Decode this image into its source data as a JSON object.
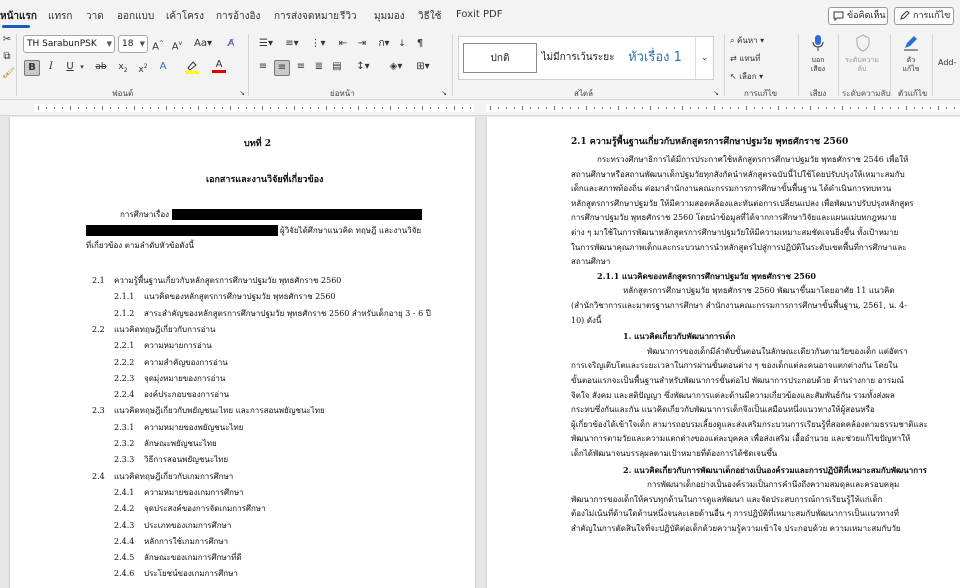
{
  "tabs": [
    "หน้าแรก",
    "แทรก",
    "วาด",
    "ออกแบบ",
    "เค้าโครง",
    "การอ้างอิง",
    "การส่งจดหมาย",
    "รีวิว",
    "มุมมอง",
    "วิธีใช้",
    "Foxit PDF"
  ],
  "active_tab": "หน้าแรก",
  "top_buttons": {
    "comments": "ข้อคิดเห็น",
    "editing": "การแก้ไข"
  },
  "ribbon": {
    "font_name": "TH SarabunPSK",
    "font_size": "18",
    "groups": {
      "font": "ฟอนต์",
      "paragraph": "ย่อหน้า",
      "styles": "สไตล์",
      "editing": "การแก้ไข",
      "voice": "เสียง",
      "sensitivity": "ระดับความลับ",
      "editor": "ตัวแก้ไข"
    },
    "styles": {
      "normal": "ปกติ",
      "no_spacing": "ไม่มีการเว้นระยะ",
      "heading1": "หัวเรื่อง 1"
    },
    "editing_items": {
      "find": "ค้นหา",
      "replace": "แทนที่",
      "select": "เลือก"
    },
    "dictate": "บอก\nเสียง",
    "sensitivity_btn": "ระดับความ\nลับ",
    "editor_btn": "ตัว\nแก้ไข",
    "addin": "Add-"
  },
  "page1": {
    "chapter": "บทที่ 2",
    "title": "เอกสารและงานวิจัยที่เกี่ยวข้อง",
    "intro_1": "การศึกษาเรื่อง",
    "intro_2_tail": "ผู้วิจัยได้ศึกษาแนวคิด ทฤษฎี และงานวิจัย",
    "intro_3": "ที่เกี่ยวข้อง ตามลำดับหัวข้อดังนี้",
    "toc": [
      {
        "num": "2.1",
        "text": "ความรู้พื้นฐานเกี่ยวกับหลักสูตรการศึกษาปฐมวัย พุทธศักราช 2560",
        "lvl": 1
      },
      {
        "num": "2.1.1",
        "text": "แนวคิดของหลักสูตรการศึกษาปฐมวัย พุทธศักราช 2560",
        "lvl": 2
      },
      {
        "num": "2.1.2",
        "text": "สาระสำคัญของหลักสูตรการศึกษาปฐมวัย พุทธศักราช 2560 สำหรับเด็กอายุ 3 - 6 ปี",
        "lvl": 2
      },
      {
        "num": "2.2",
        "text": "แนวคิดทฤษฎีเกี่ยวกับการอ่าน",
        "lvl": 1
      },
      {
        "num": "2.2.1",
        "text": "ความหมายการอ่าน",
        "lvl": 2
      },
      {
        "num": "2.2.2",
        "text": "ความสำคัญของการอ่าน",
        "lvl": 2
      },
      {
        "num": "2.2.3",
        "text": "จุดมุ่งหมายของการอ่าน",
        "lvl": 2
      },
      {
        "num": "2.2.4",
        "text": "องค์ประกอบของการอ่าน",
        "lvl": 2
      },
      {
        "num": "2.3",
        "text": "แนวคิดทฤษฎีเกี่ยวกับพยัญชนะไทย และการสอนพยัญชนะไทย",
        "lvl": 1
      },
      {
        "num": "2.3.1",
        "text": "ความหมายของพยัญชนะไทย",
        "lvl": 2
      },
      {
        "num": "2.3.2",
        "text": "ลักษณะพยัญชนะไทย",
        "lvl": 2
      },
      {
        "num": "2.3.3",
        "text": "วิธีการสอนพยัญชนะไทย",
        "lvl": 2
      },
      {
        "num": "2.4",
        "text": "แนวคิดทฤษฎีเกี่ยวกับเกมการศึกษา",
        "lvl": 1
      },
      {
        "num": "2.4.1",
        "text": "ความหมายของเกมการศึกษา",
        "lvl": 2
      },
      {
        "num": "2.4.2",
        "text": "จุดประสงค์ของการจัดเกมการศึกษา",
        "lvl": 2
      },
      {
        "num": "2.4.3",
        "text": "ประเภทของเกมการศึกษา",
        "lvl": 2
      },
      {
        "num": "2.4.4",
        "text": "หลักการใช้เกมการศึกษา",
        "lvl": 2
      },
      {
        "num": "2.4.5",
        "text": "ลักษณะของเกมการศึกษาที่ดี",
        "lvl": 2
      },
      {
        "num": "2.4.6",
        "text": "ประโยชน์ของเกมการศึกษา",
        "lvl": 2
      }
    ]
  },
  "page2": {
    "heading": "2.1   ความรู้พื้นฐานเกี่ยวกับหลักสูตรการศึกษาปฐมวัย พุทธศักราช 2560",
    "para1": [
      "กระทรวงศึกษาธิการได้มีการประกาศใช้หลักสูตรการศึกษาปฐมวัย พุทธศักราช 2546 เพื่อให้",
      "สถานศึกษาหรือสถานพัฒนาเด็กปฐมวัยทุกสังกัดนำหลักสูตรฉบับนี้ไปใช้โดยปรับปรุงให้เหมาะสมกับ",
      "เด็กและสภาพท้องถิ่น ต่อมาสำนักงานคณะกรรมการการศึกษาขั้นพื้นฐาน ได้ดำเนินการทบทวน",
      "หลักสูตรการศึกษาปฐมวัย ให้มีความสอดคล้องและทันต่อการเปลี่ยนแปลง เพื่อพัฒนาปรับปรุงหลักสูตร",
      "การศึกษาปฐมวัย พุทธศักราช 2560 โดยนำข้อมูลที่ได้จากการศึกษาวิจัยและแผนแม่บทกฎหมาย",
      "ต่าง ๆ มาใช้ในการพัฒนาหลักสูตรการศึกษาปฐมวัยให้มีความเหมาะสมชัดเจนยิ่งขึ้น ทั้งเป้าหมาย",
      "ในการพัฒนาคุณภาพเด็กและกระบวนการนำหลักสูตรไปสู่การปฏิบัติในระดับเขตพื้นที่การศึกษาและ",
      "สถานศึกษา"
    ],
    "sub1": "2.1.1   แนวคิดของหลักสูตรการศึกษาปฐมวัย พุทธศักราช 2560",
    "para2": [
      "หลักสูตรการศึกษาปฐมวัย พุทธศักราช 2560 พัฒนาขึ้นมาโดยอาศัย 11 แนวคิด",
      "(สำนักวิชาการและมาตรฐานการศึกษา สำนักงานคณะกรรมการการศึกษาขั้นพื้นฐาน, 2561, น. 4-",
      "10) ดังนี้"
    ],
    "item1": "1.   แนวคิดเกี่ยวกับพัฒนาการเด็ก",
    "para3": [
      "พัฒนาการของเด็กมีลำดับขั้นตอนในลักษณะเดียวกันตามวัยของเด็ก แต่อัตรา",
      "การเจริญเติบโตและระยะเวลาในการผ่านขั้นตอนต่าง ๆ ของเด็กแต่ละคนอาจแตกต่างกัน โดยใน",
      "ขั้นตอนแรกจะเป็นพื้นฐานสำหรับพัฒนาการขั้นต่อไป พัฒนาการประกอบด้วย ด้านร่างกาย อารมณ์",
      "จิตใจ สังคม และสติปัญญา ซึ่งพัฒนาการแต่ละด้านมีความเกี่ยวข้องและสัมพันธ์กัน รวมทั้งส่งผล",
      "กระทบซึ่งกันและกัน แนวคิดเกี่ยวกับพัฒนาการเด็กจึงเป็นเสมือนหนึ่งแนวทางให้ผู้สอนหรือ",
      "ผู้เกี่ยวข้องได้เข้าใจเด็ก สามารถอบรมเลี้ยงดูและส่งเสริมกระบวนการเรียนรู้ที่สอดคล้องตามธรรมชาติและ",
      "พัฒนาการตามวัยและความแตกต่างของแต่ละบุคคล เพื่อส่งเสริม เอื้ออำนวย และช่วยแก้ไขปัญหาให้",
      "เด็กได้พัฒนาจนบรรลุผลตามเป้าหมายที่ต้องการได้ชัดเจนขึ้น"
    ],
    "item2": "2.   แนวคิดเกี่ยวกับการพัฒนาเด็กอย่างเป็นองค์รวมและการปฏิบัติที่เหมาะสมกับพัฒนาการ",
    "para4": [
      "การพัฒนาเด็กอย่างเป็นองค์รวมเป็นการคำนึงถึงความสมดุลและครอบคลุม",
      "พัฒนาการของเด็กให้ครบทุกด้านในการดูแลพัฒนา และจัดประสบการณ์การเรียนรู้ให้แก่เด็ก",
      "ต้องไม่เน้นที่ด้านใดด้านหนึ่งจนละเลยด้านอื่น ๆ การปฏิบัติที่เหมาะสมกับพัฒนาการเป็นแนวทางที่",
      "สำคัญในการตัดสินใจที่จะปฏิบัติต่อเด็กด้วยความรู้ความเข้าใจ ประกอบด้วย ความเหมาะสมกับวัย"
    ]
  }
}
